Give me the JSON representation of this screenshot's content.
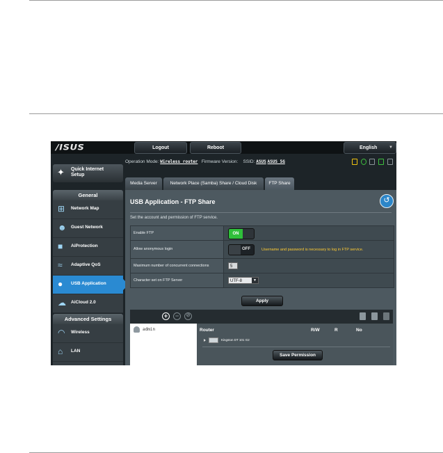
{
  "header": {
    "logo": "/ISUS",
    "logout_label": "Logout",
    "reboot_label": "Reboot",
    "language": "English",
    "language_arrow": "▼"
  },
  "status": {
    "op_mode_label": "Operation Mode:",
    "op_mode_value": "Wireless router",
    "firmware_label": "Firmware Version:",
    "ssid_label": "SSID:",
    "ssid_1": "ASUS",
    "ssid_2": "ASUS_5G"
  },
  "sidebar": {
    "qis_label": "Quick Internet Setup",
    "general_header": "General",
    "general_items": [
      {
        "label": "Network Map"
      },
      {
        "label": "Guest Network"
      },
      {
        "label": "AiProtection"
      },
      {
        "label": "Adaptive QoS"
      },
      {
        "label": "USB Application"
      },
      {
        "label": "AiCloud 2.0"
      }
    ],
    "advanced_header": "Advanced Settings",
    "advanced_items": [
      {
        "label": "Wireless"
      },
      {
        "label": "LAN"
      }
    ]
  },
  "tabs": [
    {
      "label": "Media Server"
    },
    {
      "label": "Network Place (Samba) Share / Cloud Disk"
    },
    {
      "label": "FTP Share"
    }
  ],
  "content": {
    "title": "USB Application - FTP Share",
    "back_glyph": "↺",
    "description": "Set the account and permission of FTP service.",
    "enable_ftp_label": "Enable FTP",
    "enable_ftp_state": "ON",
    "anonymous_label": "Allow anonymous login",
    "anonymous_state": "OFF",
    "anonymous_note": "Username and password is necessary to log in FTP service.",
    "max_conn_label": "Maximum number of concurrent connections",
    "max_conn_value": "5",
    "charset_label": "Character set on FTP Server",
    "charset_value": "UTF-8",
    "charset_arrow": "▼",
    "apply_label": "Apply"
  },
  "accounts": {
    "add_glyph": "+",
    "remove_glyph": "−",
    "edit_glyph": "⊘",
    "users": [
      {
        "name": "admin"
      }
    ],
    "headers": {
      "router": "Router",
      "rw": "R/W",
      "r": "R",
      "no": "No"
    },
    "drive": "Kingston DT 101 G2",
    "save_label": "Save Permission"
  },
  "colors": {
    "accent": "#2a8ad2",
    "on_green": "#2fbf3a",
    "warning": "#ffcc33",
    "panel": "#4d5960"
  }
}
